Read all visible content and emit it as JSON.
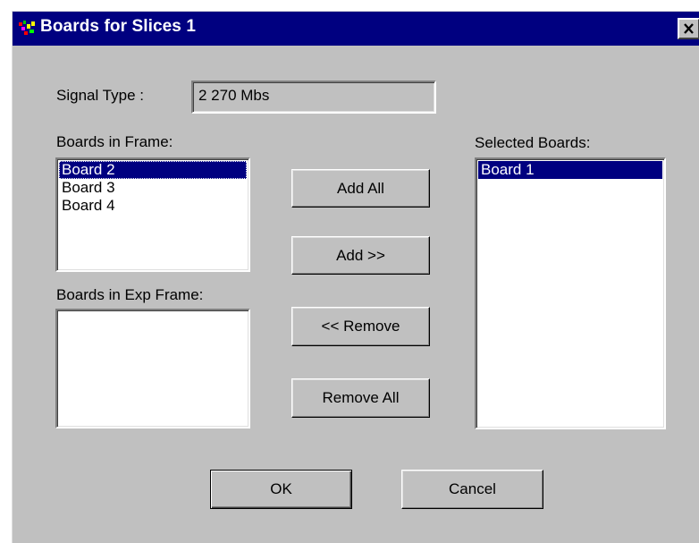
{
  "window": {
    "title": "Boards for Slices 1"
  },
  "signal_type": {
    "label": "Signal Type :",
    "value": "2  270 Mbs"
  },
  "boards_in_frame": {
    "label": "Boards in Frame:",
    "items": [
      "Board 2",
      "Board 3",
      "Board 4"
    ],
    "selected": "Board 2"
  },
  "boards_in_exp_frame": {
    "label": "Boards in Exp Frame:",
    "items": []
  },
  "selected_boards": {
    "label": "Selected Boards:",
    "items": [
      "Board 1"
    ],
    "selected": "Board 1"
  },
  "buttons": {
    "add_all": "Add All",
    "add": "Add >>",
    "remove": "<< Remove",
    "remove_all": "Remove All",
    "ok": "OK",
    "cancel": "Cancel"
  },
  "colors": {
    "titlebar": "#000080",
    "face": "#c0c0c0",
    "selection": "#000080"
  },
  "icons": {
    "app": "app-icon",
    "close": "close-icon"
  }
}
